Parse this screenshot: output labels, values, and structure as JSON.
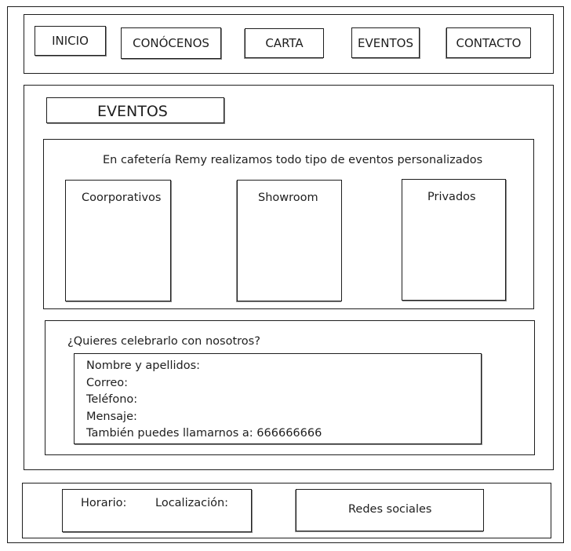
{
  "nav": {
    "items": [
      {
        "label": "INICIO"
      },
      {
        "label": "CONÓCENOS"
      },
      {
        "label": "CARTA"
      },
      {
        "label": "EVENTOS"
      },
      {
        "label": "CONTACTO"
      }
    ]
  },
  "main": {
    "title": "EVENTOS",
    "intro": "En cafetería Remy realizamos todo tipo de eventos personalizados",
    "cards": [
      {
        "label": "Coorporativos"
      },
      {
        "label": "Showroom"
      },
      {
        "label": "Privados"
      }
    ]
  },
  "contact": {
    "heading": "¿Quieres celebrarlo con nosotros?",
    "fields": [
      "Nombre y apellidos:",
      "Correo:",
      "Teléfono:",
      "Mensaje:",
      "También puedes llamarnos a: 666666666"
    ]
  },
  "footer": {
    "hours_label": "Horario:",
    "location_label": "Localización:",
    "social_label": "Redes sociales"
  }
}
